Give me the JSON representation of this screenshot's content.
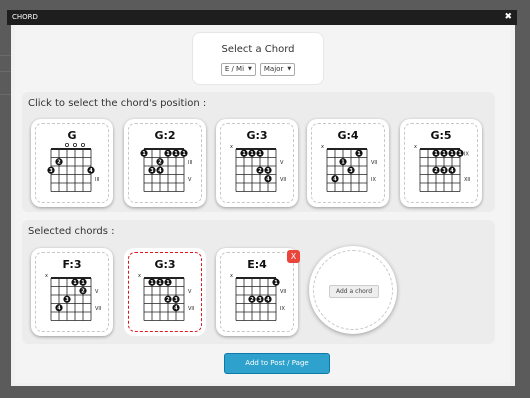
{
  "window": {
    "title": "CHORD",
    "close_glyph": "✖"
  },
  "chord_selector": {
    "title": "Select a Chord",
    "note_value": "E / Mi",
    "type_value": "Major"
  },
  "positions": {
    "label": "Click to select the chord's position :",
    "cards": [
      {
        "name": "G",
        "dots": [
          [
            1,
            2,
            "2"
          ],
          [
            0,
            3,
            "3"
          ],
          [
            5,
            3,
            "4"
          ]
        ],
        "open": [
          2,
          3,
          4
        ],
        "mute": [],
        "fret_label": "III",
        "fret_row": 3
      },
      {
        "name": "G:2",
        "dots": [
          [
            0,
            1,
            "1"
          ],
          [
            3,
            1,
            "1"
          ],
          [
            4,
            1,
            "1"
          ],
          [
            5,
            1,
            "1"
          ],
          [
            2,
            2,
            "2"
          ],
          [
            1,
            3,
            "3"
          ],
          [
            2,
            3,
            "4"
          ]
        ],
        "open": [],
        "mute": [],
        "fret_label": "III",
        "fret_row": 1,
        "fret_label2": "V",
        "fret_row2": 3
      },
      {
        "name": "G:3",
        "dots": [
          [
            1,
            1,
            "1"
          ],
          [
            2,
            1,
            "1"
          ],
          [
            3,
            1,
            "1"
          ],
          [
            3,
            3,
            "2"
          ],
          [
            4,
            3,
            "3"
          ],
          [
            4,
            4,
            "4"
          ]
        ],
        "open": [],
        "mute": [
          0
        ],
        "fret_label": "V",
        "fret_row": 1,
        "fret_label2": "VII",
        "fret_row2": 3
      },
      {
        "name": "G:4",
        "dots": [
          [
            4,
            1,
            "1"
          ],
          [
            2,
            2,
            "1"
          ],
          [
            3,
            3,
            "3"
          ],
          [
            1,
            4,
            "4"
          ]
        ],
        "open": [],
        "mute": [
          0
        ],
        "fret_label": "VII",
        "fret_row": 1,
        "fret_label2": "IX",
        "fret_row2": 3
      },
      {
        "name": "G:5",
        "dots": [
          [
            2,
            1,
            "1"
          ],
          [
            3,
            1,
            "1"
          ],
          [
            4,
            1,
            "1"
          ],
          [
            5,
            1,
            "1"
          ],
          [
            2,
            3,
            "2"
          ],
          [
            3,
            3,
            "3"
          ],
          [
            4,
            3,
            "4"
          ]
        ],
        "open": [],
        "mute": [
          0
        ],
        "fret_label": "IX",
        "fret_row": 0,
        "fret_label2": "XII",
        "fret_row2": 3
      }
    ]
  },
  "selected": {
    "label": "Selected chords :",
    "cards": [
      {
        "name": "F:3",
        "dots": [
          [
            3,
            1,
            "1"
          ],
          [
            4,
            1,
            "1"
          ],
          [
            4,
            2,
            "2"
          ],
          [
            2,
            3,
            "3"
          ],
          [
            1,
            4,
            "4"
          ]
        ],
        "open": [],
        "mute": [
          0
        ],
        "fret_label": "V",
        "fret_row": 1,
        "fret_label2": "VII",
        "fret_row2": 3
      },
      {
        "name": "G:3",
        "dots": [
          [
            1,
            1,
            "1"
          ],
          [
            2,
            1,
            "1"
          ],
          [
            3,
            1,
            "1"
          ],
          [
            3,
            3,
            "2"
          ],
          [
            4,
            3,
            "3"
          ],
          [
            4,
            4,
            "4"
          ]
        ],
        "open": [],
        "mute": [
          0
        ],
        "fret_label": "V",
        "fret_row": 1,
        "fret_label2": "VII",
        "fret_row2": 3
      },
      {
        "name": "E:4",
        "dots": [
          [
            5,
            1,
            "1"
          ],
          [
            2,
            3,
            "2"
          ],
          [
            3,
            3,
            "3"
          ],
          [
            4,
            3,
            "4"
          ]
        ],
        "open": [],
        "mute": [
          0
        ],
        "fret_label": "VII",
        "fret_row": 1,
        "fret_label2": "IX",
        "fret_row2": 3
      }
    ],
    "remove_label": "X",
    "add_chord_label": "Add a chord"
  },
  "footer": {
    "add_button_label": "Add to Post / Page"
  }
}
